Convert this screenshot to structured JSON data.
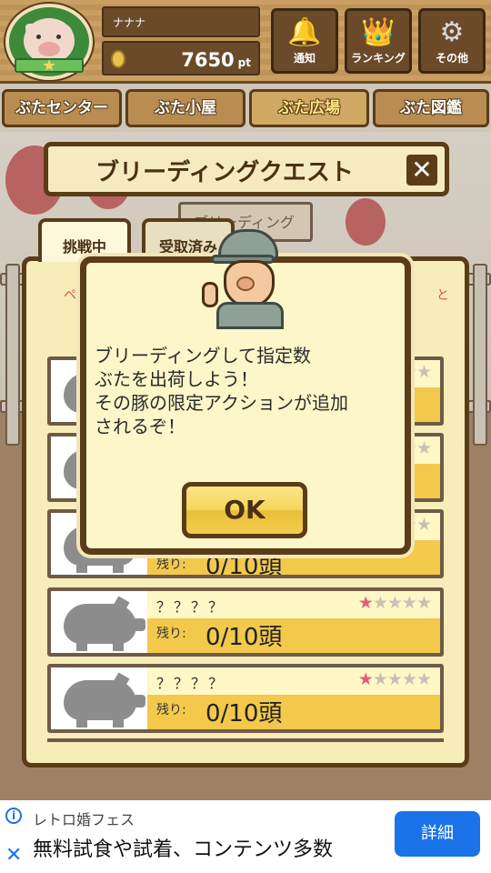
{
  "header": {
    "username": "ナナナ",
    "points": "7650",
    "points_unit": "pt",
    "buttons": [
      {
        "label": "通知",
        "icon": "bell-icon",
        "glyph": "🔔"
      },
      {
        "label": "ランキング",
        "icon": "crown-icon",
        "glyph": "👑"
      },
      {
        "label": "その他",
        "icon": "gear-icon",
        "glyph": "⚙"
      }
    ]
  },
  "nav_tabs": [
    {
      "label": "ぶたセンター",
      "active": false
    },
    {
      "label": "ぶた小屋",
      "active": false
    },
    {
      "label": "ぶた広場",
      "active": true
    },
    {
      "label": "ぶた図鑑",
      "active": false
    }
  ],
  "quest": {
    "title": "ブリーディングクエスト",
    "close": "✕",
    "sign_text": "ブリーディング",
    "tabs": [
      "挑戦中",
      "受取済み"
    ],
    "sort_left": "ペ",
    "sort_right": "と",
    "rows": [
      {
        "name": "",
        "remain_label": "",
        "count": "",
        "rating": 1
      },
      {
        "name": "",
        "remain_label": "",
        "count": "",
        "rating": 1
      },
      {
        "name": "",
        "remain_label": "残り:",
        "count": "0/10頭",
        "rating": 1
      },
      {
        "name": "？？？？",
        "remain_label": "残り:",
        "count": "0/10頭",
        "rating": 1
      },
      {
        "name": "？？？？",
        "remain_label": "残り:",
        "count": "0/10頭",
        "rating": 1
      }
    ],
    "stars_total": 5
  },
  "dialog": {
    "message_lines": [
      "ブリーディングして指定数",
      "ぶたを出荷しよう！",
      "その豚の限定アクションが追加",
      "されるぞ！"
    ],
    "ok_label": "OK"
  },
  "ad": {
    "info": "i",
    "close": "✕",
    "small": "レトロ婚フェス",
    "title": "無料試食や試着、コンテンツ多数",
    "button": "詳細"
  },
  "colors": {
    "wood": "#c69a5c",
    "dark_brown": "#5a3c18",
    "panel": "#f7edb8",
    "star_on": "#e0607a",
    "ad_blue": "#1a73e8"
  }
}
